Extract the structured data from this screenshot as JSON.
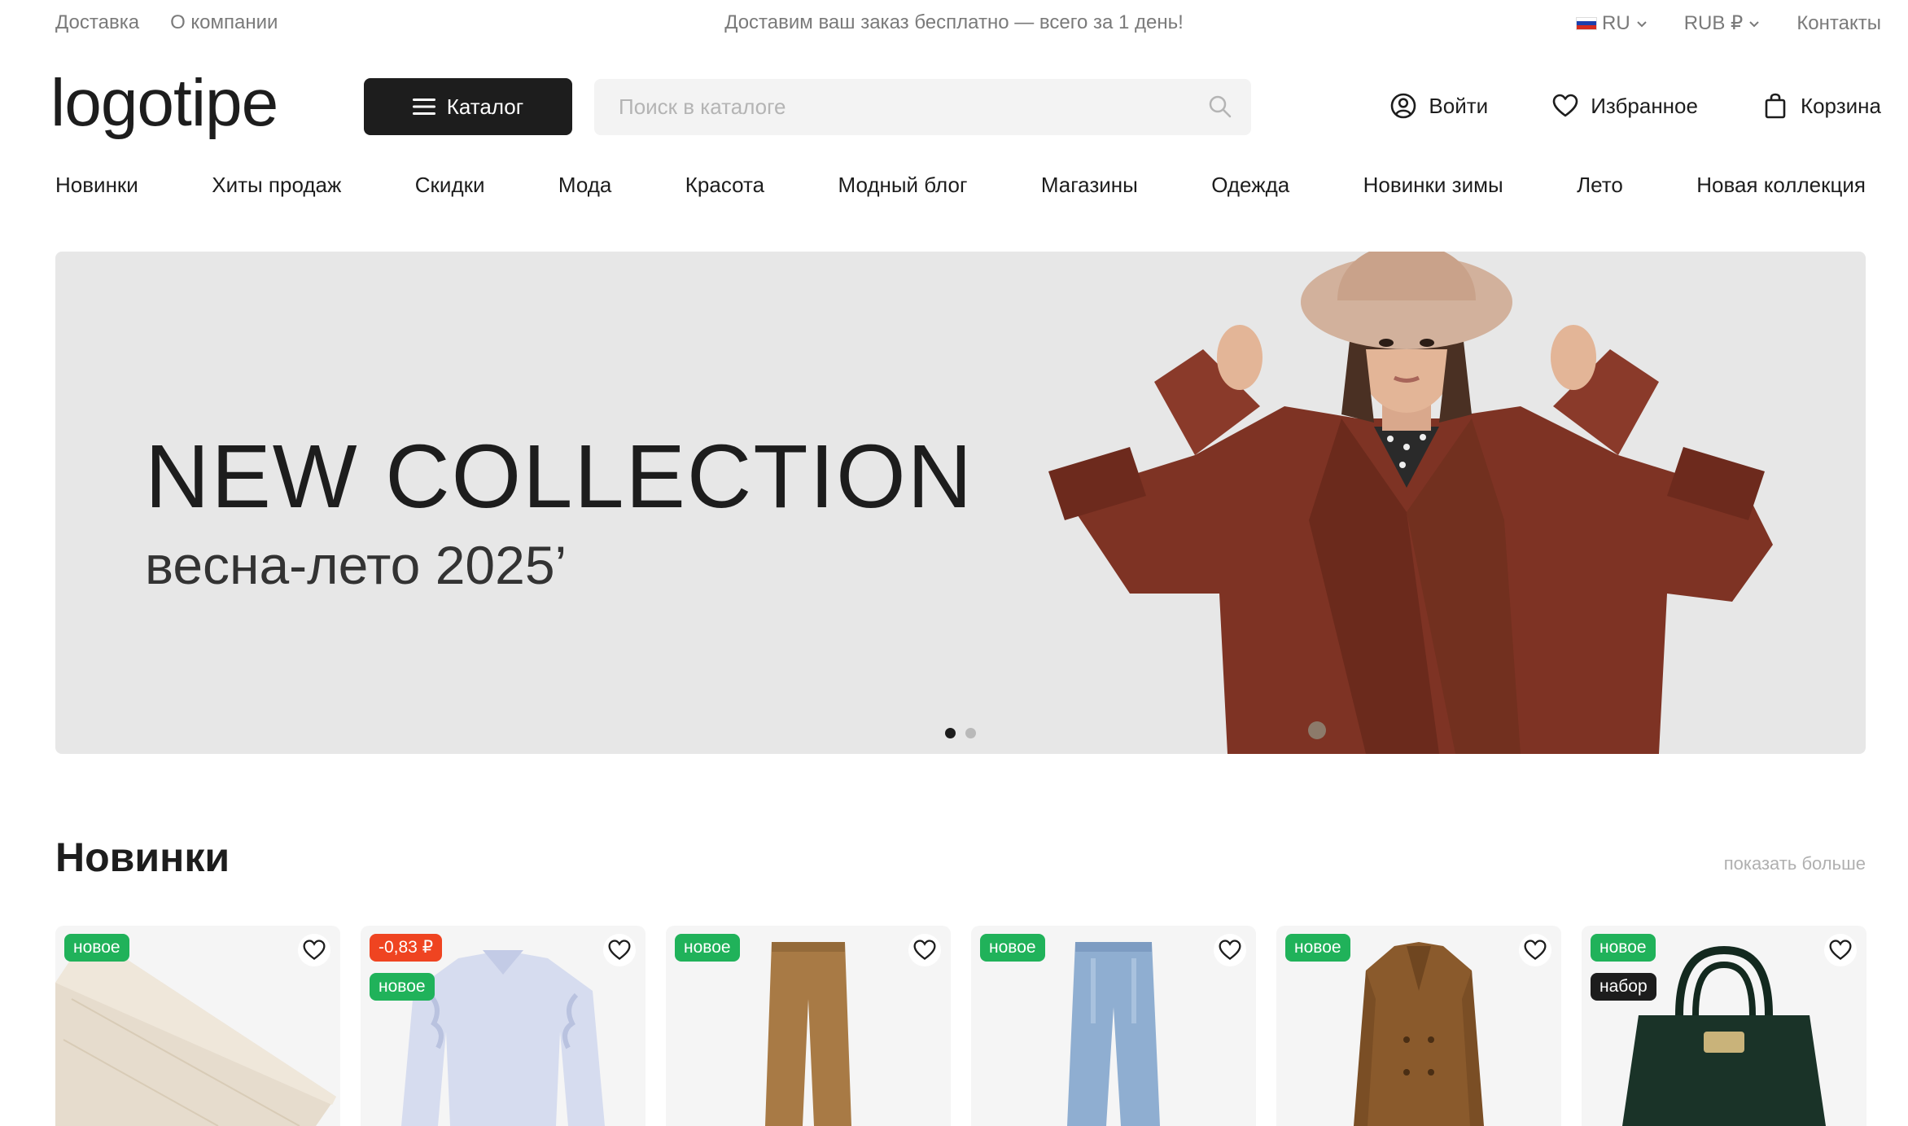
{
  "topbar": {
    "links": [
      "Доставка",
      "О компании"
    ],
    "promo": "Доставим ваш заказ бесплатно — всего за 1 день!",
    "language": "RU",
    "currency": "RUB ₽",
    "contacts": "Контакты"
  },
  "header": {
    "logo": "logotipe",
    "catalog_label": "Каталог",
    "search_placeholder": "Поиск в каталоге",
    "login": "Войти",
    "favorites": "Избранное",
    "cart": "Корзина"
  },
  "nav": [
    "Новинки",
    "Хиты продаж",
    "Скидки",
    "Мода",
    "Красота",
    "Модный блог",
    "Магазины",
    "Одежда",
    "Новинки зимы",
    "Лето",
    "Новая коллекция"
  ],
  "hero": {
    "title": "NEW COLLECTION",
    "subtitle": "весна-лето 2025’",
    "slides": 2,
    "active_slide": 1
  },
  "section": {
    "title": "Новинки",
    "more_label": "показать больше"
  },
  "products": [
    {
      "image": "laminate-board",
      "badges": [
        {
          "text": "новое",
          "type": "new"
        }
      ]
    },
    {
      "image": "ruffle-blouse",
      "badges": [
        {
          "text": "-0,83 ₽",
          "type": "sale"
        },
        {
          "text": "новое",
          "type": "new"
        }
      ]
    },
    {
      "image": "brown-trousers",
      "badges": [
        {
          "text": "новое",
          "type": "new"
        }
      ]
    },
    {
      "image": "blue-jeans",
      "badges": [
        {
          "text": "новое",
          "type": "new"
        }
      ]
    },
    {
      "image": "brown-coat",
      "badges": [
        {
          "text": "новое",
          "type": "new"
        }
      ]
    },
    {
      "image": "black-handbag",
      "badges": [
        {
          "text": "новое",
          "type": "new"
        },
        {
          "text": "набор",
          "type": "set"
        }
      ]
    }
  ],
  "colors": {
    "dark": "#1d1d1d",
    "badge_new": "#20b25a",
    "badge_sale": "#ef4421",
    "hero_bg": "#e7e7e7"
  }
}
